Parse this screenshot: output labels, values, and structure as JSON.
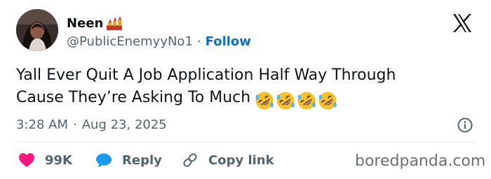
{
  "author": {
    "display_name": "Neen",
    "name_emoji": "lipstick-icon",
    "handle": "@PublicEnemyyNo1",
    "separator": "·",
    "follow_label": "Follow"
  },
  "tweet": {
    "line1": "Yall Ever Quit A Job Application Half Way Through",
    "line2": "Cause They’re Asking To Much",
    "emojis": [
      "rolling-on-floor-laughing-icon",
      "rolling-on-floor-laughing-icon",
      "rolling-on-floor-laughing-icon",
      "rolling-on-floor-laughing-icon"
    ]
  },
  "meta": {
    "time": "3:28 AM",
    "separator": "·",
    "date": "Aug 23, 2025"
  },
  "actions": {
    "likes_count": "99K",
    "reply_label": "Reply",
    "copy_link_label": "Copy link"
  },
  "watermark": "boredpanda.com",
  "colors": {
    "like": "#f91880",
    "reply": "#1d9bf0",
    "follow": "#0f6fc6",
    "secondary_text": "#536471",
    "primary_text": "#0f1419",
    "emoji_face": "#f7c12c"
  }
}
